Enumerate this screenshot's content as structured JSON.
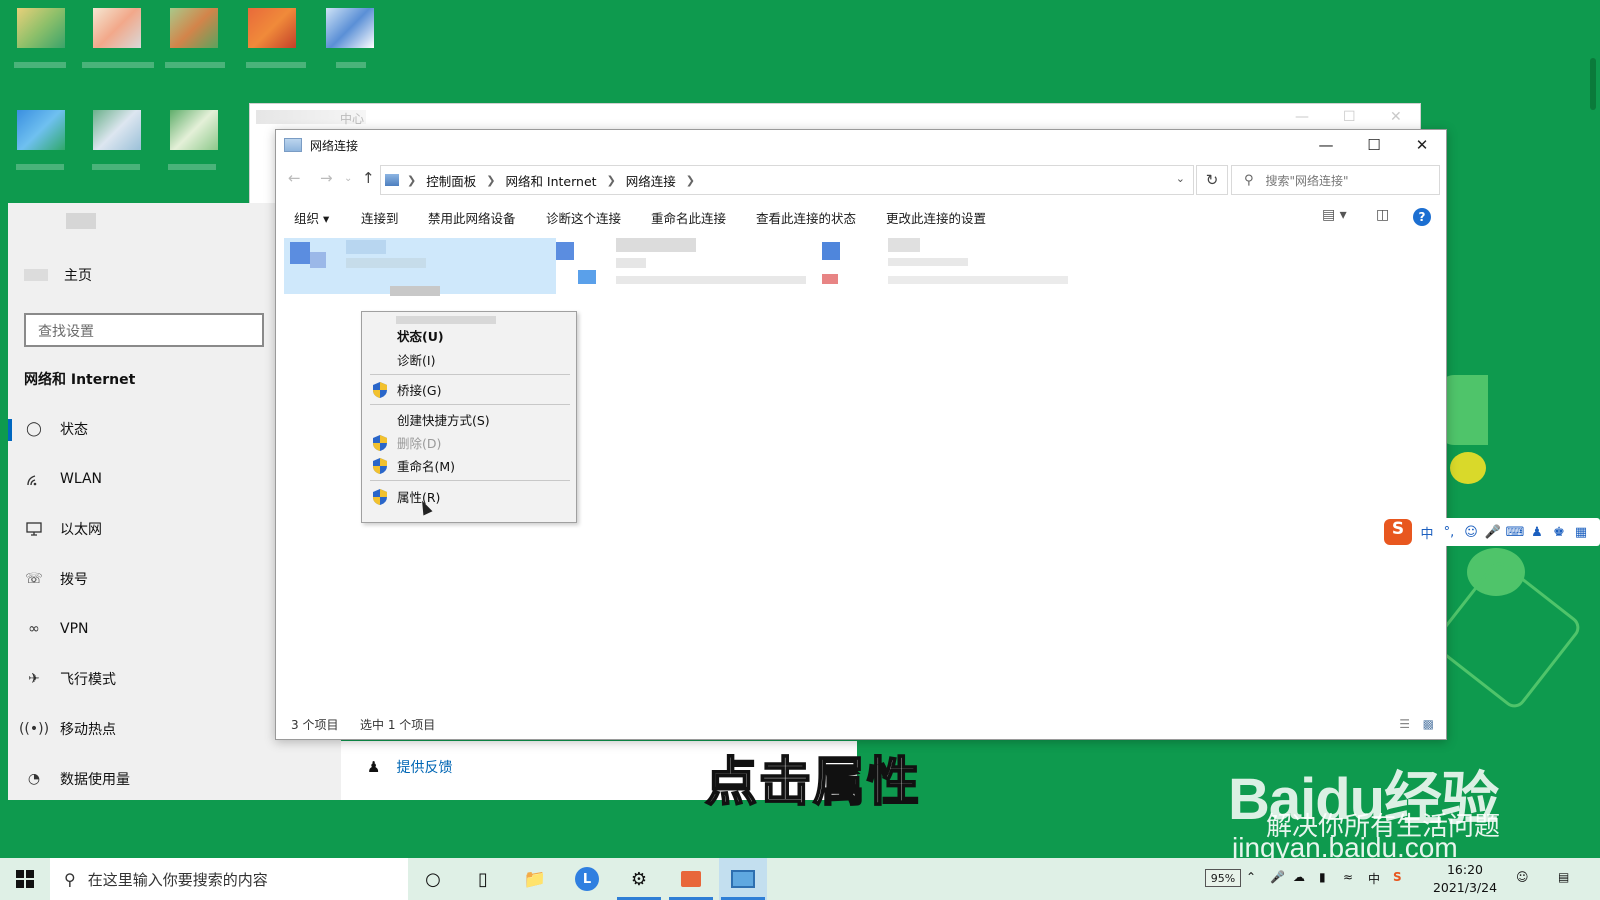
{
  "settings": {
    "home_label": "主页",
    "search_placeholder": "查找设置",
    "heading": "网络和 Internet",
    "items": [
      {
        "label": "状态",
        "icon": "globe-icon"
      },
      {
        "label": "WLAN",
        "icon": "wifi-icon"
      },
      {
        "label": "以太网",
        "icon": "ethernet-icon"
      },
      {
        "label": "拨号",
        "icon": "dialup-icon"
      },
      {
        "label": "VPN",
        "icon": "vpn-icon"
      },
      {
        "label": "飞行模式",
        "icon": "airplane-icon"
      },
      {
        "label": "移动热点",
        "icon": "hotspot-icon"
      },
      {
        "label": "数据使用量",
        "icon": "data-usage-icon"
      }
    ],
    "feedback_label": "提供反馈"
  },
  "back_window": {
    "title_fragment": "中心"
  },
  "explorer": {
    "title": "网络连接",
    "breadcrumbs": [
      "控制面板",
      "网络和 Internet",
      "网络连接"
    ],
    "search_placeholder": "搜索\"网络连接\"",
    "commands": {
      "organize": "组织",
      "connect_to": "连接到",
      "disable_device": "禁用此网络设备",
      "diagnose": "诊断这个连接",
      "rename": "重命名此连接",
      "view_status": "查看此连接的状态",
      "change_settings": "更改此连接的设置"
    },
    "status": {
      "item_count": "3 个项目",
      "selected": "选中 1 个项目"
    }
  },
  "context_menu": {
    "status": "状态(U)",
    "diagnose": "诊断(I)",
    "bridge": "桥接(G)",
    "create_shortcut": "创建快捷方式(S)",
    "delete": "删除(D)",
    "rename": "重命名(M)",
    "properties": "属性(R)"
  },
  "ime_toolbar": {
    "logo": "S",
    "mode": "中",
    "punct": "°,"
  },
  "caption": "点击属性",
  "watermark": {
    "brand": "Baidu经验",
    "slogan": "解决你所有生活问题",
    "url": "jingyan.baidu.com"
  },
  "taskbar": {
    "search_placeholder": "在这里输入你要搜索的内容",
    "battery": "95%",
    "time": "16:20",
    "date": "2021/3/24",
    "ime_indicator": "中"
  },
  "colors": {
    "wallpaper": "#0e9a4e",
    "accent": "#0067c0",
    "link": "#0066b4",
    "sogou": "#e8571f"
  }
}
